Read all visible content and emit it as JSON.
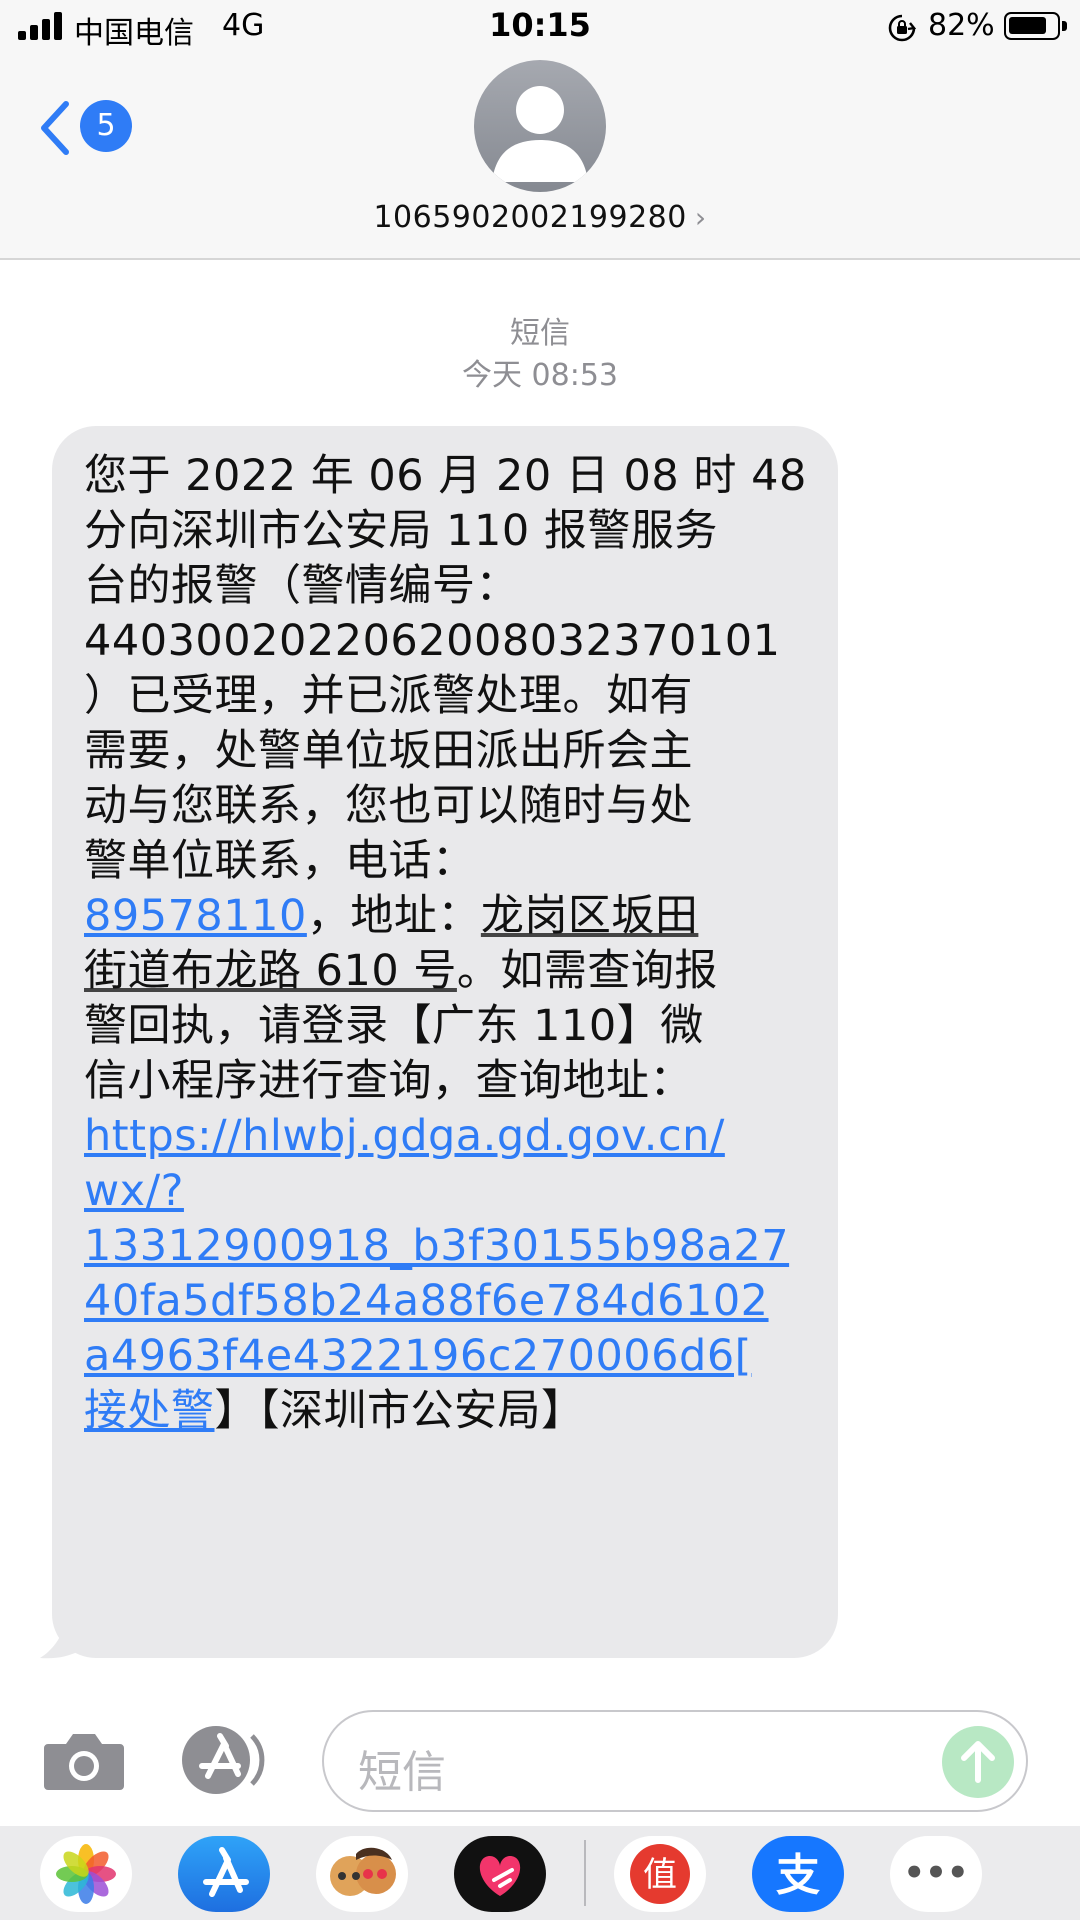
{
  "status_bar": {
    "carrier": "中国电信",
    "network": "4G",
    "time": "10:15",
    "battery_percent": "82%",
    "battery_level": 0.82,
    "icons": [
      "signal-icon",
      "orientation-lock-icon",
      "battery-icon"
    ]
  },
  "header": {
    "back_badge_count": "5",
    "contact_number": "1065902002199280",
    "chevron": "›",
    "icons": [
      "back-chevron-icon",
      "contact-avatar-icon",
      "chevron-right-icon"
    ]
  },
  "conversation": {
    "service_label": "短信",
    "timestamp": "今天 08:53",
    "message_lines": [
      [
        {
          "t": "您于 2022 年 06 月 20 日 08 时 48"
        }
      ],
      [
        {
          "t": "分向深圳市公安局 110 报警服务"
        }
      ],
      [
        {
          "t": "台的报警（警情编号："
        }
      ],
      [
        {
          "t": "440300202206200803237010 1",
          "raw": "4403002022062008032370101"
        }
      ],
      [
        {
          "t": "）已受理，并已派警处理。如有"
        }
      ],
      [
        {
          "t": "需要，处警单位坂田派出所会主"
        }
      ],
      [
        {
          "t": "动与您联系，您也可以随时与处"
        }
      ],
      [
        {
          "t": "警单位联系，电话："
        }
      ],
      [
        {
          "t": "89578110",
          "link": true
        },
        {
          "t": "，地址："
        },
        {
          "t": "龙岗区坂田",
          "underline": true
        }
      ],
      [
        {
          "t": "街道布龙路 610 号",
          "underline": true
        },
        {
          "t": "。如需查询报"
        }
      ],
      [
        {
          "t": "警回执，请登录【广东 110】微"
        }
      ],
      [
        {
          "t": "信小程序进行查询，查询地址："
        }
      ],
      [
        {
          "t": "https://hlwbj.gdga.gd.gov.cn/",
          "link": true
        }
      ],
      [
        {
          "t": "wx/?",
          "link": true
        }
      ],
      [
        {
          "t": "13312900918_b3f30155b98a27",
          "link": true
        }
      ],
      [
        {
          "t": "40fa5df58b24a88f6e784d6102",
          "link": true
        }
      ],
      [
        {
          "t": "a4963f4e4322196c270006d6[",
          "link": true
        }
      ],
      [
        {
          "t": "接处警",
          "link": true
        },
        {
          "t": "】【深圳市公安局】"
        }
      ]
    ],
    "link_color": "#2f7cf6",
    "bubble_color": "#e9e9eb"
  },
  "input_bar": {
    "placeholder": "短信",
    "icons": [
      "camera-icon",
      "app-store-icon",
      "send-arrow-icon"
    ],
    "send_color": "#b8e8c4"
  },
  "app_drawer": {
    "apps": [
      {
        "name": "photos-app-icon"
      },
      {
        "name": "app-store-app-icon"
      },
      {
        "name": "memoji-app-icon"
      },
      {
        "name": "digital-touch-app-icon"
      },
      {
        "name": "zhi-app-icon",
        "label": "值"
      },
      {
        "name": "alipay-app-icon",
        "label": "支"
      },
      {
        "name": "more-apps-icon",
        "label": "•••"
      }
    ]
  }
}
